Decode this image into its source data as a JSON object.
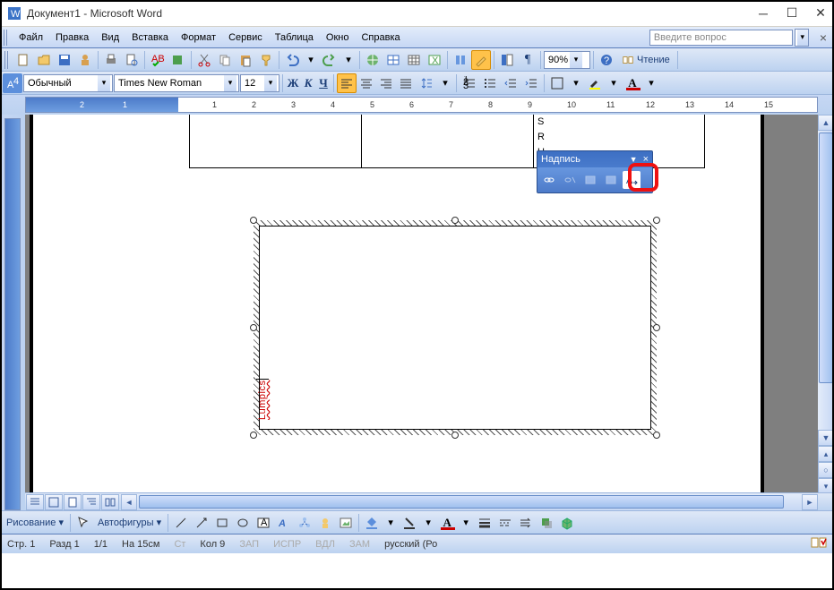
{
  "window": {
    "title": "Документ1 - Microsoft Word"
  },
  "menus": {
    "file": "Файл",
    "edit": "Правка",
    "view": "Вид",
    "insert": "Вставка",
    "format": "Формат",
    "service": "Сервис",
    "table": "Таблица",
    "window": "Окно",
    "help": "Справка"
  },
  "askbox": {
    "placeholder": "Введите вопрос"
  },
  "toolbar1": {
    "zoom": "90%",
    "read": "Чтение"
  },
  "formatbar": {
    "style": "Обычный",
    "font": "Times New Roman",
    "size": "12",
    "bold": "Ж",
    "italic": "К",
    "underline": "Ч"
  },
  "ruler": {
    "marks_neg": [
      "2",
      "1"
    ],
    "marks": [
      "1",
      "2",
      "3",
      "4",
      "5",
      "6",
      "7",
      "8",
      "9",
      "10",
      "11",
      "12",
      "13",
      "14",
      "15"
    ]
  },
  "document": {
    "table_cell_text": [
      "S",
      "R",
      "U"
    ],
    "textbox_text": "Lumpics"
  },
  "float_panel": {
    "title": "Надпись"
  },
  "drawbar": {
    "drawing": "Рисование",
    "autoshapes": "Автофигуры"
  },
  "status": {
    "page": "Стр. 1",
    "section": "Разд 1",
    "pages": "1/1",
    "at": "На 15см",
    "ln": "Ст",
    "col": "Кол 9",
    "rec": "ЗАП",
    "trk": "ИСПР",
    "ext": "ВДЛ",
    "ovr": "ЗАМ",
    "lang": "русский (Ро"
  }
}
